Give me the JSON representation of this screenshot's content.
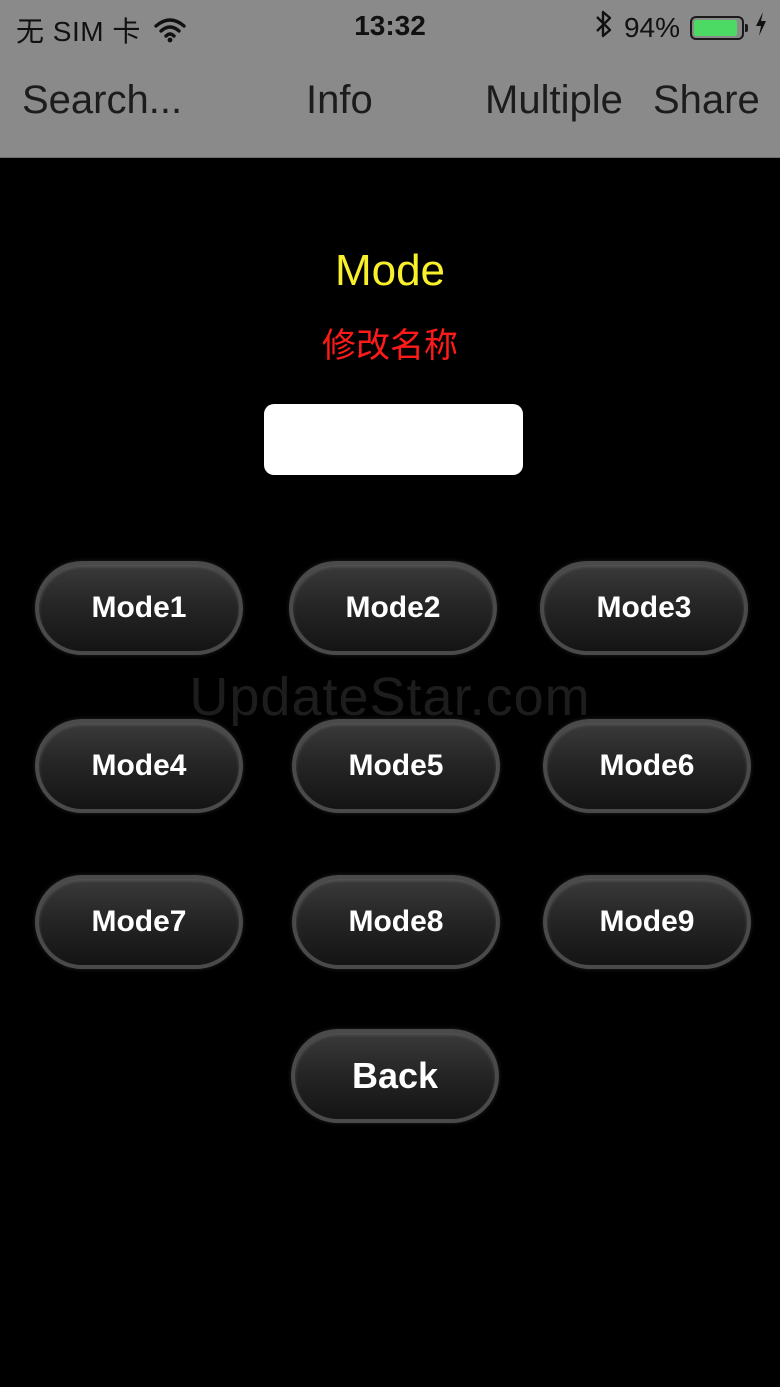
{
  "status_bar": {
    "carrier": "无 SIM 卡",
    "time": "13:32",
    "battery_percent": "94%",
    "battery_level": 0.94,
    "battery_color": "#4cd964"
  },
  "nav": {
    "search": "Search...",
    "info": "Info",
    "multiple": "Multiple",
    "share": "Share"
  },
  "main": {
    "title": "Mode",
    "subtitle": "修改名称",
    "name_input_value": "",
    "name_input_placeholder": "",
    "modes": [
      "Mode1",
      "Mode2",
      "Mode3",
      "Mode4",
      "Mode5",
      "Mode6",
      "Mode7",
      "Mode8",
      "Mode9"
    ],
    "back_label": "Back",
    "title_color": "#f7f02a",
    "subtitle_color": "#ff1a1a"
  },
  "watermark": "UpdateStar.com"
}
